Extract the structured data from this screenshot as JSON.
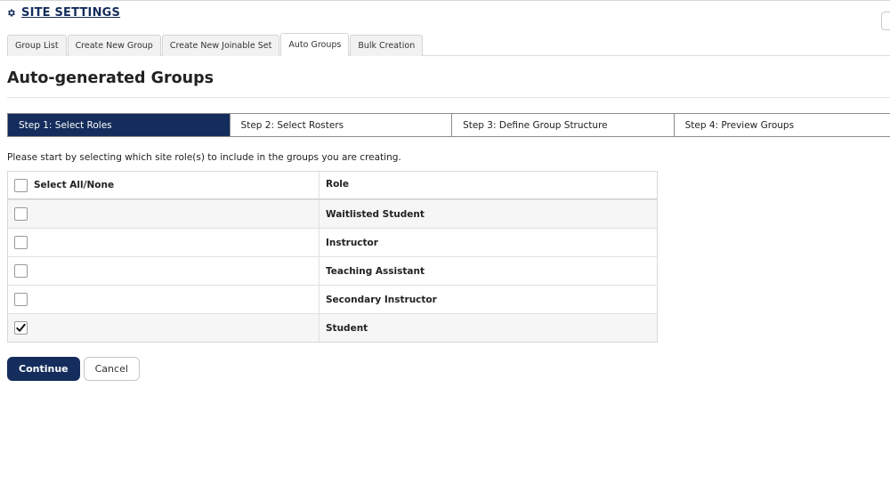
{
  "header": {
    "title": "SITE SETTINGS",
    "icon": "gear-icon"
  },
  "tabs": [
    {
      "label": "Group List",
      "active": false
    },
    {
      "label": "Create New Group",
      "active": false
    },
    {
      "label": "Create New Joinable Set",
      "active": false
    },
    {
      "label": "Auto Groups",
      "active": true
    },
    {
      "label": "Bulk Creation",
      "active": false
    }
  ],
  "page": {
    "title": "Auto-generated Groups",
    "instructions": "Please start by selecting which site role(s) to include in the groups you are creating."
  },
  "steps": [
    {
      "label": "Step 1: Select Roles",
      "active": true
    },
    {
      "label": "Step 2: Select Rosters",
      "active": false
    },
    {
      "label": "Step 3: Define Group Structure",
      "active": false
    },
    {
      "label": "Step 4: Preview Groups",
      "active": false
    }
  ],
  "table": {
    "select_all_label": "Select All/None",
    "role_header": "Role",
    "rows": [
      {
        "role": "Waitlisted Student",
        "checked": false
      },
      {
        "role": "Instructor",
        "checked": false
      },
      {
        "role": "Teaching Assistant",
        "checked": false
      },
      {
        "role": "Secondary Instructor",
        "checked": false
      },
      {
        "role": "Student",
        "checked": true
      }
    ]
  },
  "buttons": {
    "continue_label": "Continue",
    "cancel_label": "Cancel"
  },
  "colors": {
    "primary": "#152d5c"
  }
}
